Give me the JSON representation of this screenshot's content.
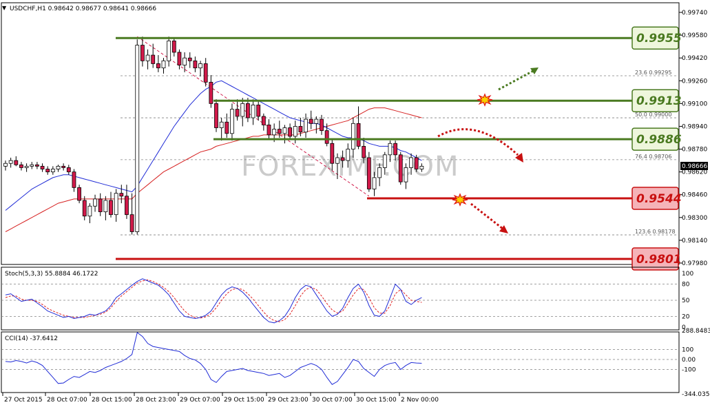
{
  "header": {
    "arrow": "▼",
    "text": "USDCHF,H1  0.98642 0.98677 0.98641 0.98666"
  },
  "stoch_label": "Stoch(5,3,3) 55.8884 46.1722",
  "cci_label": "CCI(14) -37.6412",
  "watermark": "FOREXIMF.COM",
  "colors": {
    "bull": "#ffffff",
    "bear": "#d11a4a",
    "ma_blue": "#1f2bd6",
    "ma_red": "#d62020",
    "green_level": "#4a7a20",
    "red_level": "#c81010",
    "fib": "#808080"
  },
  "fib_labels": {
    "f236": "23.6   0.99295",
    "f500": "50.0   0.99000",
    "f764": "76.4   0.98706",
    "f1236": "123.6  0.98178"
  },
  "current_price": "0.98666",
  "level_boxes": [
    {
      "label": "0.9955",
      "price": 0.9956,
      "kind": "resistance",
      "line_start_x": "28 Oct 15:00"
    },
    {
      "label": "0.9913",
      "price": 0.9912,
      "kind": "resistance",
      "line_start_x": "29 Oct 07:00"
    },
    {
      "label": "0.9886",
      "price": 0.9885,
      "kind": "resistance",
      "line_start_x": "29 Oct 07:00"
    },
    {
      "label": "0.9544",
      "price": 0.9844,
      "kind": "support",
      "line_start_x": "30 Oct 07:00"
    },
    {
      "label": "0.9801",
      "price": 0.9801,
      "kind": "support",
      "line_start_x": "28 Oct 15:00"
    }
  ],
  "chart_data": {
    "type": "candlestick",
    "symbol": "USDCHF",
    "timeframe": "H1",
    "price_axis": {
      "labels": [
        "0.99740",
        "0.99580",
        "0.99420",
        "0.99260",
        "0.99100",
        "0.98940",
        "0.98780",
        "0.98620",
        "0.98460",
        "0.98300",
        "0.98140",
        "0.97980"
      ],
      "ylim": [
        0.9787,
        0.9982
      ]
    },
    "time_axis_labels": [
      "27 Oct 2015",
      "28 Oct 07:00",
      "28 Oct 15:00",
      "28 Oct 23:00",
      "29 Oct 07:00",
      "29 Oct 15:00",
      "29 Oct 23:00",
      "30 Oct 07:00",
      "30 Oct 15:00",
      "2 Nov 00:00"
    ],
    "candles_ohlc": [
      [
        0.9866,
        0.987,
        0.9863,
        0.9868
      ],
      [
        0.9868,
        0.9872,
        0.9865,
        0.987
      ],
      [
        0.987,
        0.9873,
        0.9866,
        0.9867
      ],
      [
        0.9867,
        0.9869,
        0.9863,
        0.9865
      ],
      [
        0.9865,
        0.9868,
        0.9862,
        0.9866
      ],
      [
        0.9866,
        0.9869,
        0.9864,
        0.9867
      ],
      [
        0.9867,
        0.9869,
        0.9864,
        0.9866
      ],
      [
        0.9866,
        0.9868,
        0.9862,
        0.9864
      ],
      [
        0.9864,
        0.9866,
        0.986,
        0.9862
      ],
      [
        0.9862,
        0.9866,
        0.986,
        0.9864
      ],
      [
        0.9864,
        0.9867,
        0.9862,
        0.9866
      ],
      [
        0.9866,
        0.9868,
        0.9863,
        0.9865
      ],
      [
        0.9865,
        0.9867,
        0.986,
        0.9862
      ],
      [
        0.9862,
        0.9864,
        0.9848,
        0.9851
      ],
      [
        0.9851,
        0.9853,
        0.984,
        0.9842
      ],
      [
        0.9842,
        0.9845,
        0.9828,
        0.9831
      ],
      [
        0.9831,
        0.984,
        0.9826,
        0.9838
      ],
      [
        0.9838,
        0.9846,
        0.9834,
        0.9843
      ],
      [
        0.9843,
        0.9847,
        0.9831,
        0.9834
      ],
      [
        0.9834,
        0.9845,
        0.9828,
        0.9842
      ],
      [
        0.9842,
        0.9848,
        0.983,
        0.9832
      ],
      [
        0.9832,
        0.985,
        0.9827,
        0.9847
      ],
      [
        0.9847,
        0.9853,
        0.984,
        0.9845
      ],
      [
        0.9845,
        0.9853,
        0.9829,
        0.9832
      ],
      [
        0.9832,
        0.9847,
        0.9818,
        0.982
      ],
      [
        0.982,
        0.9955,
        0.9818,
        0.9951
      ],
      [
        0.9951,
        0.9957,
        0.9936,
        0.994
      ],
      [
        0.994,
        0.9948,
        0.9934,
        0.9944
      ],
      [
        0.9944,
        0.9952,
        0.9935,
        0.9938
      ],
      [
        0.9938,
        0.9944,
        0.9932,
        0.9935
      ],
      [
        0.9935,
        0.9942,
        0.9931,
        0.994
      ],
      [
        0.994,
        0.9957,
        0.9936,
        0.9954
      ],
      [
        0.9954,
        0.9956,
        0.9943,
        0.9946
      ],
      [
        0.9946,
        0.9948,
        0.9934,
        0.9937
      ],
      [
        0.9937,
        0.9946,
        0.9932,
        0.9942
      ],
      [
        0.9942,
        0.9946,
        0.9935,
        0.994
      ],
      [
        0.994,
        0.9943,
        0.9932,
        0.9935
      ],
      [
        0.9935,
        0.994,
        0.9929,
        0.9938
      ],
      [
        0.9938,
        0.9942,
        0.9922,
        0.9925
      ],
      [
        0.9925,
        0.993,
        0.9907,
        0.991
      ],
      [
        0.991,
        0.9913,
        0.989,
        0.9893
      ],
      [
        0.9893,
        0.99,
        0.9884,
        0.9897
      ],
      [
        0.9897,
        0.9903,
        0.9886,
        0.9889
      ],
      [
        0.9889,
        0.991,
        0.9884,
        0.9906
      ],
      [
        0.9906,
        0.9913,
        0.9898,
        0.9901
      ],
      [
        0.9901,
        0.9914,
        0.9894,
        0.991
      ],
      [
        0.991,
        0.9914,
        0.9897,
        0.99
      ],
      [
        0.99,
        0.9913,
        0.9895,
        0.9909
      ],
      [
        0.9909,
        0.9912,
        0.9898,
        0.9901
      ],
      [
        0.9901,
        0.9903,
        0.9891,
        0.9895
      ],
      [
        0.9895,
        0.9899,
        0.9885,
        0.9888
      ],
      [
        0.9888,
        0.9896,
        0.9883,
        0.9892
      ],
      [
        0.9892,
        0.9898,
        0.9886,
        0.9889
      ],
      [
        0.9889,
        0.9895,
        0.9882,
        0.9893
      ],
      [
        0.9893,
        0.9896,
        0.9885,
        0.9887
      ],
      [
        0.9887,
        0.9898,
        0.9882,
        0.9894
      ],
      [
        0.9894,
        0.99,
        0.9887,
        0.989
      ],
      [
        0.989,
        0.9903,
        0.9886,
        0.9899
      ],
      [
        0.9899,
        0.9905,
        0.9892,
        0.9896
      ],
      [
        0.9896,
        0.9901,
        0.9889,
        0.9899
      ],
      [
        0.9899,
        0.9902,
        0.9888,
        0.9891
      ],
      [
        0.9891,
        0.9896,
        0.988,
        0.9882
      ],
      [
        0.9882,
        0.9885,
        0.9863,
        0.9868
      ],
      [
        0.9868,
        0.9875,
        0.9857,
        0.9872
      ],
      [
        0.9872,
        0.9877,
        0.9865,
        0.987
      ],
      [
        0.987,
        0.9882,
        0.9865,
        0.9878
      ],
      [
        0.9878,
        0.99,
        0.9872,
        0.9896
      ],
      [
        0.9896,
        0.9908,
        0.9878,
        0.988
      ],
      [
        0.988,
        0.9886,
        0.9868,
        0.9872
      ],
      [
        0.9872,
        0.9876,
        0.9848,
        0.985
      ],
      [
        0.985,
        0.9862,
        0.9845,
        0.9858
      ],
      [
        0.9858,
        0.9868,
        0.9852,
        0.9865
      ],
      [
        0.9865,
        0.9876,
        0.986,
        0.9874
      ],
      [
        0.9874,
        0.9884,
        0.9869,
        0.9882
      ],
      [
        0.9882,
        0.9884,
        0.987,
        0.9874
      ],
      [
        0.9874,
        0.9876,
        0.9853,
        0.9855
      ],
      [
        0.9855,
        0.9868,
        0.985,
        0.9865
      ],
      [
        0.9865,
        0.9875,
        0.986,
        0.9872
      ],
      [
        0.9872,
        0.9874,
        0.9862,
        0.9864
      ],
      [
        0.9864,
        0.9868,
        0.9862,
        0.9866
      ]
    ],
    "indicators": {
      "ma_blue": [
        0.9835,
        0.9838,
        0.9841,
        0.9844,
        0.9847,
        0.985,
        0.9852,
        0.9854,
        0.9856,
        0.9858,
        0.9859,
        0.986,
        0.986,
        0.9859,
        0.9858,
        0.9857,
        0.9856,
        0.9855,
        0.9854,
        0.9853,
        0.9852,
        0.9851,
        0.985,
        0.9849,
        0.9848,
        0.9852,
        0.9858,
        0.9864,
        0.987,
        0.9876,
        0.9882,
        0.9888,
        0.9894,
        0.9899,
        0.9904,
        0.9909,
        0.9913,
        0.9917,
        0.992,
        0.9922,
        0.9925,
        0.9926,
        0.9924,
        0.9922,
        0.992,
        0.9918,
        0.9916,
        0.9914,
        0.9912,
        0.991,
        0.9908,
        0.9906,
        0.9904,
        0.9902,
        0.99,
        0.9899,
        0.9898,
        0.9897,
        0.9896,
        0.9896,
        0.9895,
        0.9893,
        0.9891,
        0.9889,
        0.9887,
        0.9886,
        0.9886,
        0.9885,
        0.9884,
        0.9882,
        0.9881,
        0.988,
        0.988,
        0.988,
        0.9879,
        0.9877,
        0.9876,
        0.9874,
        0.9872,
        0.987
      ],
      "ma_red": [
        0.982,
        0.9822,
        0.9824,
        0.9826,
        0.9828,
        0.983,
        0.9832,
        0.9834,
        0.9836,
        0.9838,
        0.984,
        0.9841,
        0.9842,
        0.9843,
        0.9843,
        0.9843,
        0.9843,
        0.9843,
        0.9843,
        0.9843,
        0.9843,
        0.9843,
        0.9843,
        0.9843,
        0.9843,
        0.9847,
        0.985,
        0.9853,
        0.9856,
        0.9859,
        0.9862,
        0.9864,
        0.9866,
        0.9868,
        0.987,
        0.9872,
        0.9874,
        0.9876,
        0.9877,
        0.9878,
        0.988,
        0.9881,
        0.9882,
        0.9883,
        0.9884,
        0.9885,
        0.9886,
        0.9887,
        0.9887,
        0.9888,
        0.9888,
        0.9888,
        0.9888,
        0.9888,
        0.9888,
        0.9888,
        0.9889,
        0.989,
        0.9891,
        0.9892,
        0.9893,
        0.9894,
        0.9895,
        0.9896,
        0.9897,
        0.9898,
        0.99,
        0.9902,
        0.9904,
        0.9906,
        0.9907,
        0.9907,
        0.9907,
        0.9906,
        0.9905,
        0.9904,
        0.9903,
        0.9902,
        0.9901,
        0.99
      ],
      "stoch_axis_labels": [
        "100",
        "80",
        "50",
        "20",
        "0"
      ],
      "stoch_main": [
        60,
        62,
        55,
        48,
        50,
        52,
        45,
        38,
        30,
        26,
        22,
        18,
        20,
        16,
        18,
        20,
        24,
        22,
        26,
        30,
        40,
        55,
        62,
        70,
        78,
        85,
        90,
        86,
        82,
        78,
        70,
        60,
        45,
        30,
        20,
        18,
        16,
        18,
        22,
        30,
        45,
        60,
        70,
        75,
        72,
        65,
        55,
        42,
        30,
        18,
        10,
        8,
        12,
        20,
        35,
        55,
        70,
        78,
        75,
        60,
        45,
        30,
        20,
        24,
        35,
        55,
        72,
        80,
        65,
        40,
        22,
        20,
        30,
        55,
        80,
        70,
        48,
        42,
        50,
        55
      ],
      "stoch_signal": [
        55,
        58,
        58,
        52,
        50,
        50,
        48,
        42,
        35,
        30,
        26,
        22,
        20,
        18,
        18,
        18,
        20,
        22,
        24,
        28,
        36,
        48,
        58,
        66,
        74,
        82,
        86,
        88,
        85,
        80,
        74,
        66,
        55,
        42,
        30,
        22,
        18,
        17,
        19,
        25,
        36,
        50,
        62,
        70,
        72,
        70,
        62,
        52,
        40,
        28,
        18,
        12,
        10,
        14,
        24,
        40,
        58,
        70,
        74,
        70,
        58,
        44,
        32,
        26,
        30,
        44,
        60,
        72,
        70,
        55,
        36,
        26,
        26,
        40,
        62,
        70,
        60,
        50,
        48,
        46
      ],
      "cci_axis_labels": [
        "288.8483",
        "100",
        "0.00",
        "-100",
        "-344.0358"
      ],
      "cci": [
        -20,
        -25,
        -10,
        -20,
        -35,
        -15,
        -30,
        -60,
        -120,
        -180,
        -240,
        -235,
        -200,
        -170,
        -180,
        -150,
        -120,
        -130,
        -110,
        -80,
        -60,
        -40,
        -20,
        10,
        50,
        270,
        230,
        160,
        130,
        120,
        110,
        100,
        90,
        80,
        40,
        10,
        -5,
        -40,
        -100,
        -200,
        -230,
        -170,
        -120,
        -110,
        -100,
        -90,
        -110,
        -120,
        -130,
        -140,
        -160,
        -150,
        -140,
        -180,
        -160,
        -120,
        -80,
        -60,
        -40,
        -60,
        -100,
        -180,
        -250,
        -220,
        -150,
        -80,
        0,
        -20,
        -90,
        -130,
        -170,
        -100,
        -60,
        -40,
        -30,
        -100,
        -60,
        -30,
        -35,
        -38
      ],
      "stoch_values_label": "Stoch(5,3,3) 55.8884 46.1722",
      "cci_value_label": "CCI(14) -37.6412"
    }
  }
}
